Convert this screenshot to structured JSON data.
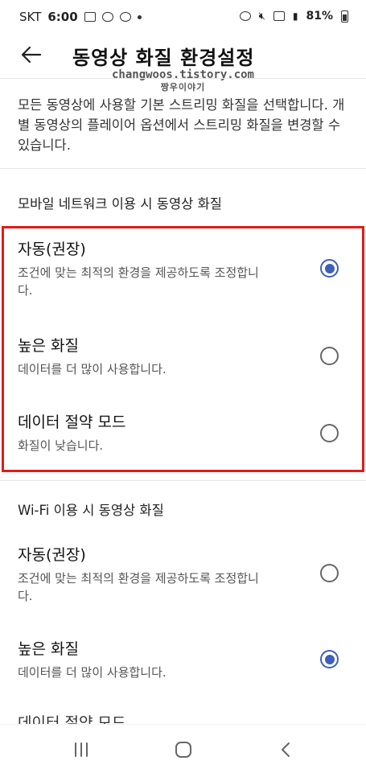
{
  "status_bar": {
    "carrier": "SKT",
    "time": "6:00",
    "battery": "81%"
  },
  "header": {
    "title": "동영상 화질 환경설정"
  },
  "watermark": {
    "line1": "changwoos.tistory.com",
    "line2": "짱우이야기"
  },
  "description": "모든 동영상에 사용할 기본 스트리밍 화질을 선택합니다. 개별 동영상의 플레이어 옵션에서 스트리밍 화질을 변경할 수 있습니다.",
  "mobile_section": {
    "label": "모바일 네트워크 이용 시 동영상 화질",
    "options": [
      {
        "title": "자동(권장)",
        "desc": "조건에 맞는 최적의 환경을 제공하도록 조정합니다.",
        "selected": true
      },
      {
        "title": "높은 화질",
        "desc": "데이터를 더 많이 사용합니다.",
        "selected": false
      },
      {
        "title": "데이터 절약 모드",
        "desc": "화질이 낮습니다.",
        "selected": false
      }
    ]
  },
  "wifi_section": {
    "label": "Wi-Fi 이용 시 동영상 화질",
    "options": [
      {
        "title": "자동(권장)",
        "desc": "조건에 맞는 최적의 환경을 제공하도록 조정합니다.",
        "selected": false
      },
      {
        "title": "높은 화질",
        "desc": "데이터를 더 많이 사용합니다.",
        "selected": true
      },
      {
        "title": "데이터 절약 모드",
        "desc": "",
        "selected": false
      }
    ]
  },
  "colors": {
    "accent": "#3e5fb8",
    "highlight": "#e21b1b"
  }
}
